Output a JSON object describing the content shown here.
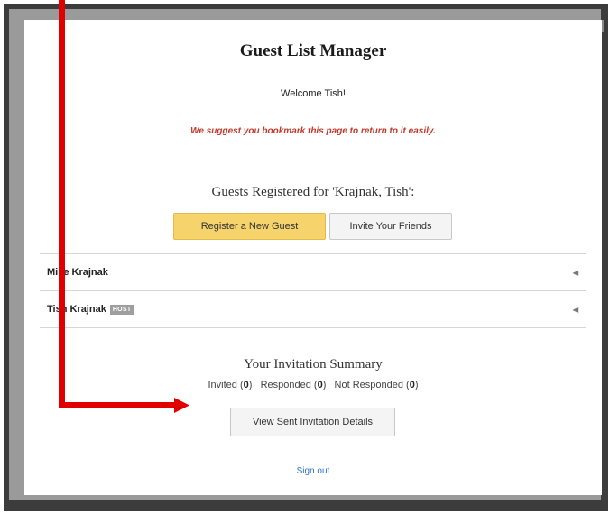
{
  "page": {
    "title": "Guest List Manager",
    "welcome": "Welcome Tish!",
    "bookmark_notice": "We suggest you bookmark this page to return to it easily."
  },
  "guests_section": {
    "heading": "Guests Registered for 'Krajnak, Tish':",
    "register_button": "Register a New Guest",
    "invite_button": "Invite Your Friends",
    "guests": [
      {
        "name": "Mike Krajnak",
        "badge": ""
      },
      {
        "name": "Tish Krajnak",
        "badge": "HOST"
      }
    ]
  },
  "summary": {
    "heading": "Your Invitation Summary",
    "invited_label": "Invited (",
    "invited_count": "0",
    "responded_label": ")   Responded (",
    "responded_count": "0",
    "not_responded_label": ")   Not Responded (",
    "not_responded_count": "0",
    "close_paren": ")",
    "view_button": "View Sent Invitation Details"
  },
  "footer": {
    "signout": "Sign out"
  },
  "colors": {
    "accent_button": "#f6d36b",
    "notice_red": "#c0392b",
    "link_blue": "#2a6fd6",
    "annotation_arrow": "#e00000"
  },
  "icons": {
    "collapse": "caret-left-icon"
  }
}
